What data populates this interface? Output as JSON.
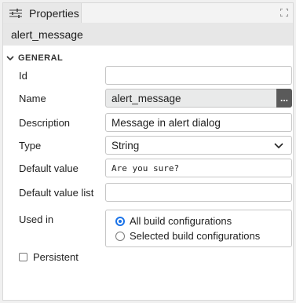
{
  "panel": {
    "tab_label": "Properties",
    "tab_icon": "sliders-icon",
    "maximize_icon": "maximize-icon"
  },
  "header": {
    "title": "alert_message"
  },
  "section": {
    "title": "GENERAL",
    "expanded": true
  },
  "fields": {
    "id": {
      "label": "Id",
      "value": ""
    },
    "name": {
      "label": "Name",
      "value": "alert_message",
      "button_label": "..."
    },
    "description": {
      "label": "Description",
      "value": "Message in alert dialog"
    },
    "type": {
      "label": "Type",
      "value": "String"
    },
    "default_value": {
      "label": "Default value",
      "value": "Are you sure?"
    },
    "default_value_list": {
      "label": "Default value list",
      "value": ""
    },
    "used_in": {
      "label": "Used in",
      "options": [
        {
          "label": "All build configurations",
          "selected": true
        },
        {
          "label": "Selected build configurations",
          "selected": false
        }
      ]
    },
    "persistent": {
      "label": "Persistent",
      "checked": false
    }
  },
  "colors": {
    "accent": "#1a73e8",
    "header_bg": "#e7e7e7",
    "readonly_bg": "#e9eaea"
  }
}
